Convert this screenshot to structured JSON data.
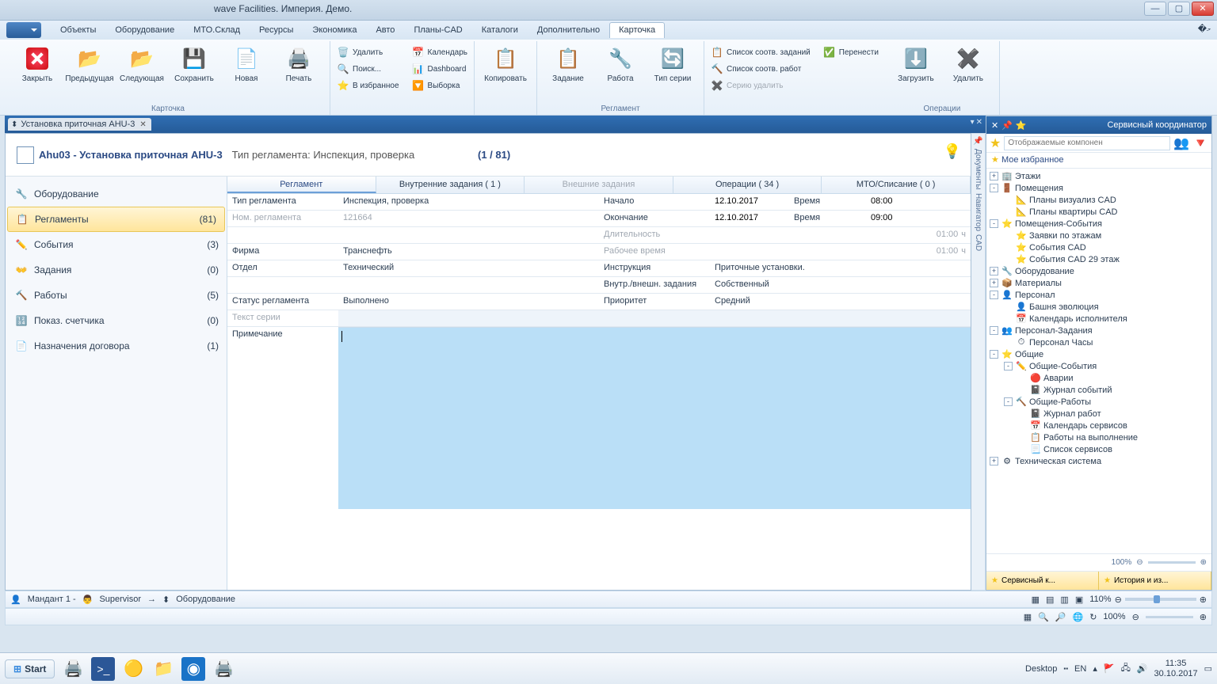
{
  "title": "wave Facilities. Империя. Демо.",
  "menu": [
    "Объекты",
    "Оборудование",
    "МТО.Склад",
    "Ресурсы",
    "Экономика",
    "Авто",
    "Планы-CAD",
    "Каталоги",
    "Дополнительно",
    "Карточка"
  ],
  "menu_active": 9,
  "ribbon": {
    "groups": {
      "card": {
        "label": "Карточка",
        "big": [
          "Закрыть",
          "Предыдущая",
          "Следующая",
          "Сохранить",
          "Новая",
          "Печать"
        ],
        "small1": [
          "Удалить",
          "Поиск...",
          "В избранное"
        ],
        "small2": [
          "Календарь",
          "Dashboard",
          "Выборка"
        ],
        "big2": [
          "Копировать"
        ]
      },
      "reg": {
        "label": "Регламент",
        "big": [
          "Задание",
          "Работа",
          "Тип серии"
        ],
        "small": [
          "Список соотв. заданий",
          "Список соотв. работ",
          "Серию удалить"
        ],
        "small_r": [
          "Перенести"
        ]
      },
      "ops": {
        "label": "Операции",
        "big": [
          "Загрузить",
          "Удалить"
        ]
      }
    }
  },
  "doctab": "Установка приточная AHU-3",
  "card": {
    "code": "Ahu03",
    "name": "Установка приточная AHU-3",
    "reg_type_lbl": "Тип регламента:",
    "reg_type": "Инспекция, проверка",
    "counter": "(1 / 81)"
  },
  "sidenav": [
    {
      "label": "Оборудование",
      "count": "",
      "sel": false,
      "ico": "🔧"
    },
    {
      "label": "Регламенты",
      "count": "(81)",
      "sel": true,
      "ico": "📋"
    },
    {
      "label": "События",
      "count": "(3)",
      "sel": false,
      "ico": "✏️"
    },
    {
      "label": "Задания",
      "count": "(0)",
      "sel": false,
      "ico": "👐"
    },
    {
      "label": "Работы",
      "count": "(5)",
      "sel": false,
      "ico": "🔨"
    },
    {
      "label": "Показ. счетчика",
      "count": "(0)",
      "sel": false,
      "ico": "🔢"
    },
    {
      "label": "Назначения договора",
      "count": "(1)",
      "sel": false,
      "ico": "📄"
    }
  ],
  "formtabs": [
    {
      "label": "Регламент",
      "act": true
    },
    {
      "label": "Внутренние задания ( 1 )"
    },
    {
      "label": "Внешние задания",
      "dis": true
    },
    {
      "label": "Операции ( 34 )"
    },
    {
      "label": "МТО/Списание ( 0 )"
    }
  ],
  "fields": {
    "tip_reg_l": "Тип регламента",
    "tip_reg_v": "Инспекция, проверка",
    "nom_reg_l": "Ном. регламента",
    "nom_reg_v": "121664",
    "firma_l": "Фирма",
    "firma_v": "Транснефть",
    "otdel_l": "Отдел",
    "otdel_v": "Технический",
    "status_l": "Статус регламента",
    "status_v": "Выполнено",
    "series_l": "Текст серии",
    "series_v": "",
    "note_l": "Примечание",
    "nachalo_l": "Начало",
    "nachalo_v": "12.10.2017",
    "vremya_l": "Время",
    "vremya_v1": "08:00",
    "okon_l": "Окончание",
    "okon_v": "12.10.2017",
    "vremya_v2": "09:00",
    "dlit_l": "Длительность",
    "dlit_v": "01:00",
    "unit": "ч",
    "rab_l": "Рабочее время",
    "rab_v": "01:00",
    "instr_l": "Инструкция",
    "instr_v": "Приточные установки.",
    "vnutr_l": "Внутр./внешн. задания",
    "vnutr_v": "Собственный",
    "prio_l": "Приоритет",
    "prio_v": "Средний"
  },
  "rightstrip": [
    "Документы",
    "Навигатор",
    "CAD"
  ],
  "navpanel": {
    "title": "Сервисный координатор",
    "search_ph": "Отображаемые компонен",
    "fav": "Мое избранное",
    "tree": [
      {
        "l": 1,
        "exp": "+",
        "ico": "🏢",
        "t": "Этажи"
      },
      {
        "l": 1,
        "exp": "-",
        "ico": "🚪",
        "t": "Помещения"
      },
      {
        "l": 2,
        "exp": "",
        "ico": "📐",
        "t": "Планы визуализ CAD"
      },
      {
        "l": 2,
        "exp": "",
        "ico": "📐",
        "t": "Планы квартиры CAD"
      },
      {
        "l": 1,
        "exp": "-",
        "ico": "⭐",
        "t": "Помещения-События"
      },
      {
        "l": 2,
        "exp": "",
        "ico": "⭐",
        "t": "Заявки по этажам"
      },
      {
        "l": 2,
        "exp": "",
        "ico": "⭐",
        "t": "События CAD"
      },
      {
        "l": 2,
        "exp": "",
        "ico": "⭐",
        "t": "События CAD 29 этаж"
      },
      {
        "l": 1,
        "exp": "+",
        "ico": "🔧",
        "t": "Оборудование"
      },
      {
        "l": 1,
        "exp": "+",
        "ico": "📦",
        "t": "Материалы"
      },
      {
        "l": 1,
        "exp": "-",
        "ico": "👤",
        "t": "Персонал"
      },
      {
        "l": 2,
        "exp": "",
        "ico": "👤",
        "t": "Башня эволюция"
      },
      {
        "l": 2,
        "exp": "",
        "ico": "📅",
        "t": "Календарь исполнителя"
      },
      {
        "l": 1,
        "exp": "-",
        "ico": "👥",
        "t": "Персонал-Задания"
      },
      {
        "l": 2,
        "exp": "",
        "ico": "⏱",
        "t": "Персонал Часы"
      },
      {
        "l": 1,
        "exp": "-",
        "ico": "⭐",
        "t": "Общие"
      },
      {
        "l": 2,
        "exp": "-",
        "ico": "✏️",
        "t": "Общие-События"
      },
      {
        "l": 3,
        "exp": "",
        "ico": "🔴",
        "t": "Аварии"
      },
      {
        "l": 3,
        "exp": "",
        "ico": "📓",
        "t": "Журнал событий"
      },
      {
        "l": 2,
        "exp": "-",
        "ico": "🔨",
        "t": "Общие-Работы"
      },
      {
        "l": 3,
        "exp": "",
        "ico": "📓",
        "t": "Журнал работ"
      },
      {
        "l": 3,
        "exp": "",
        "ico": "📅",
        "t": "Календарь сервисов"
      },
      {
        "l": 3,
        "exp": "",
        "ico": "📋",
        "t": "Работы на выполнение"
      },
      {
        "l": 3,
        "exp": "",
        "ico": "📃",
        "t": "Список сервисов"
      },
      {
        "l": 1,
        "exp": "+",
        "ico": "⚙",
        "t": "Техническая система"
      }
    ],
    "zoom": "100%",
    "bottabs": [
      "Сервисный к...",
      "История и из..."
    ]
  },
  "statusbar2": {
    "mandant": "Мандант 1 -",
    "user": "Supervisor",
    "arrow": "→",
    "equip": "Оборудование",
    "zoom": "110%"
  },
  "statusbar3": {
    "zoom": "100%"
  },
  "taskbar": {
    "start": "Start",
    "desktop": "Desktop",
    "lang": "EN",
    "time": "11:35",
    "date": "30.10.2017"
  }
}
